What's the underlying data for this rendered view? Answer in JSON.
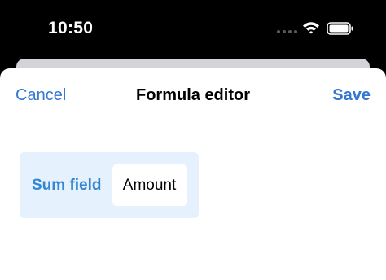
{
  "status_bar": {
    "time": "10:50",
    "icons": [
      "cellular-signal-icon",
      "wifi-icon",
      "battery-icon"
    ]
  },
  "nav": {
    "cancel_label": "Cancel",
    "title": "Formula editor",
    "save_label": "Save"
  },
  "formula": {
    "field_label": "Sum field",
    "field_value": "Amount"
  },
  "colors": {
    "accent": "#3478cf",
    "chip_background": "#e5f2fd",
    "status_bar_background": "#000000"
  }
}
